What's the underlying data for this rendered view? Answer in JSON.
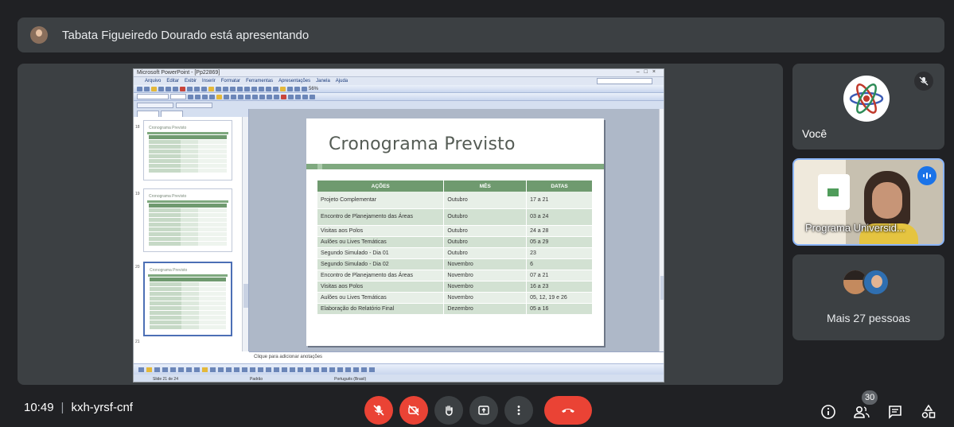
{
  "banner": {
    "presenter_text": "Tabata Figueiredo Dourado está apresentando"
  },
  "presentation": {
    "window_title": "Microsoft PowerPoint - [Pp22869]",
    "menu": [
      "Arquivo",
      "Editar",
      "Exibir",
      "Inserir",
      "Formatar",
      "Ferramentas",
      "Apresentações",
      "Janela",
      "Ajuda"
    ],
    "zoom": "56%",
    "thumbnail_title": "Cronograma Previsto",
    "slide_numbers": [
      "18",
      "19",
      "20",
      "21"
    ],
    "notes_placeholder": "Clique para adicionar anotações",
    "status_slide": "Slide 21 de 24",
    "status_design": "Padrão",
    "status_language": "Português (Brasil)",
    "slide": {
      "title": "Cronograma Previsto",
      "headers": [
        "AÇÕES",
        "MÊS",
        "DATAS"
      ],
      "rows": [
        {
          "acao": "Projeto Complementar",
          "mes": "Outubro",
          "datas": "17 a 21"
        },
        {
          "acao": "Encontro de Planejamento das Áreas",
          "mes": "Outubro",
          "datas": "03 a 24"
        },
        {
          "acao": "Visitas aos Polos",
          "mes": "Outubro",
          "datas": "24 a 28"
        },
        {
          "acao": "Aulões ou Lives Temáticas",
          "mes": "Outubro",
          "datas": "05 a 29"
        },
        {
          "acao": "Segundo Simulado - Dia 01",
          "mes": "Outubro",
          "datas": "23"
        },
        {
          "acao": "Segundo Simulado - Dia 02",
          "mes": "Novembro",
          "datas": "6"
        },
        {
          "acao": "Encontro de Planejamento das Áreas",
          "mes": "Novembro",
          "datas": "07 a 21"
        },
        {
          "acao": "Visitas aos Polos",
          "mes": "Novembro",
          "datas": "16 a 23"
        },
        {
          "acao": "Aulões ou Lives Temáticas",
          "mes": "Novembro",
          "datas": "05, 12, 19 e 26"
        },
        {
          "acao": "Elaboração do Relatório Final",
          "mes": "Dezembro",
          "datas": "05 a 16"
        }
      ]
    }
  },
  "participants": {
    "you_label": "Você",
    "program_label": "Programa Universid...",
    "more_label": "Mais 27 pessoas"
  },
  "bottom": {
    "time": "10:49",
    "separator": "|",
    "meeting_code": "kxh-yrsf-cnf",
    "participant_count": "30",
    "icons": {
      "mic": "mic-off-icon",
      "camera": "camera-off-icon",
      "hand": "raise-hand-icon",
      "present": "present-screen-icon",
      "more": "more-options-icon",
      "end": "end-call-icon",
      "info": "info-icon",
      "people": "people-icon",
      "chat": "chat-icon",
      "activities": "activities-icon"
    }
  },
  "colors": {
    "background": "#202124",
    "tile": "#3c4043",
    "end_call": "#ea4335",
    "active_speaker": "#1a73e8",
    "slide_green": "#6f9a6f"
  }
}
